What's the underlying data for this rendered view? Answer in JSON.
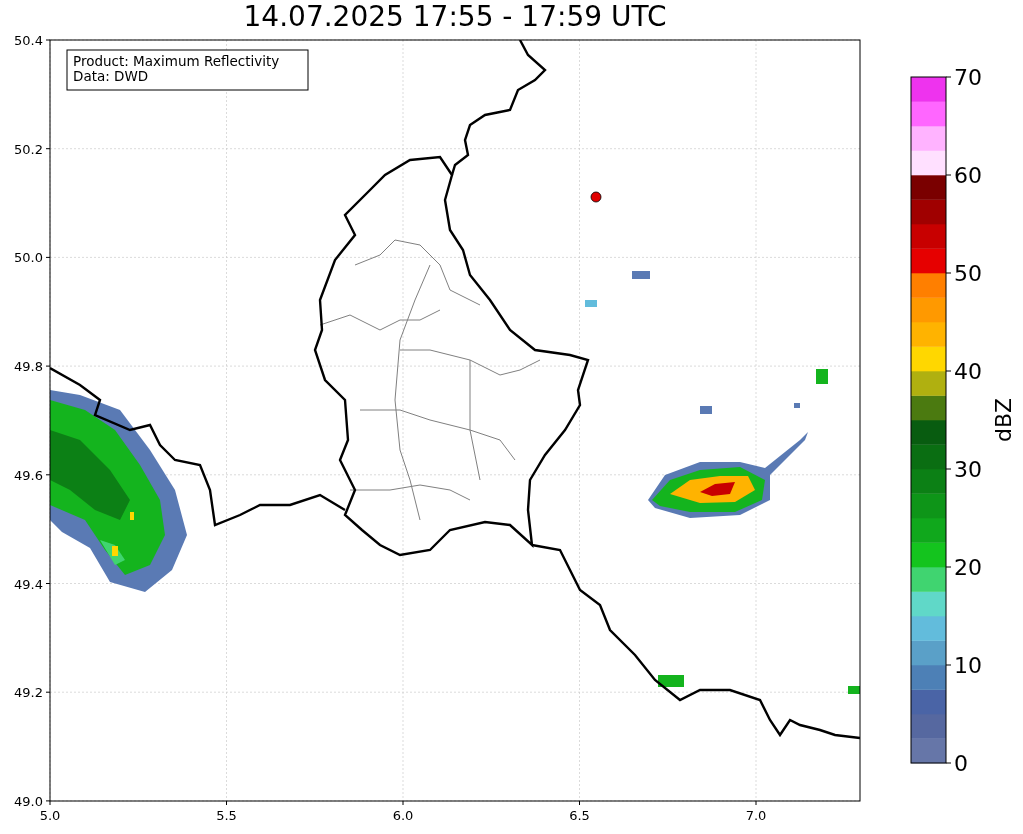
{
  "title": "14.07.2025 17:55 - 17:59 UTC",
  "info_box": [
    "Product: Maximum Reflectivity",
    "Data: DWD"
  ],
  "x_axis": {
    "ticks": [
      "5.0",
      "5.5",
      "6.0",
      "6.5",
      "7.0"
    ]
  },
  "y_axis": {
    "ticks": [
      "50.4",
      "50.2",
      "50.0",
      "49.8",
      "49.6",
      "49.4",
      "49.2",
      "49.0"
    ]
  },
  "colorbar": {
    "label": "dBZ",
    "ticks": [
      "70",
      "60",
      "50",
      "40",
      "30",
      "20",
      "10",
      "0"
    ],
    "segments": [
      {
        "color": "#6676a8"
      },
      {
        "color": "#5668a0"
      },
      {
        "color": "#4a64a6"
      },
      {
        "color": "#4d80b6"
      },
      {
        "color": "#5aa0c8"
      },
      {
        "color": "#62bcdc"
      },
      {
        "color": "#60d8c8"
      },
      {
        "color": "#40d470"
      },
      {
        "color": "#14c41e"
      },
      {
        "color": "#10a81c"
      },
      {
        "color": "#0e9518"
      },
      {
        "color": "#0c8015"
      },
      {
        "color": "#0a6e12"
      },
      {
        "color": "#085c10"
      },
      {
        "color": "#4b7a10"
      },
      {
        "color": "#b0b010"
      },
      {
        "color": "#ffd700"
      },
      {
        "color": "#ffb300"
      },
      {
        "color": "#ff9900"
      },
      {
        "color": "#ff7f00"
      },
      {
        "color": "#e60000"
      },
      {
        "color": "#c80000"
      },
      {
        "color": "#a00000"
      },
      {
        "color": "#7a0000"
      },
      {
        "color": "#ffe0ff"
      },
      {
        "color": "#ffb3ff"
      },
      {
        "color": "#ff66ff"
      },
      {
        "color": "#ee33ee"
      }
    ]
  }
}
